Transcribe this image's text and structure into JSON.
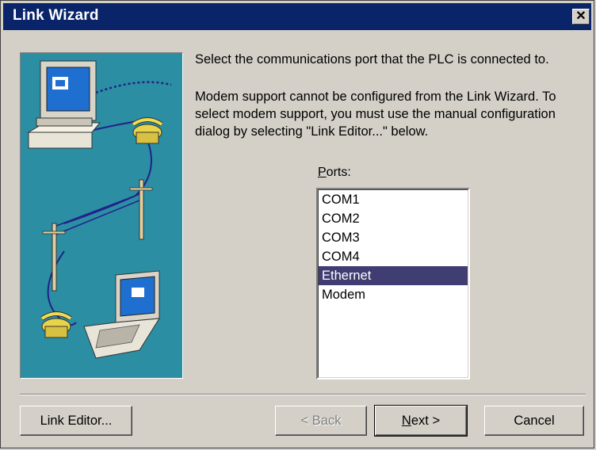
{
  "window": {
    "title": "Link Wizard",
    "close_glyph": "✕"
  },
  "text": {
    "instruction": "Select the communications port that the PLC is connected to.",
    "modem_note": "Modem support cannot be configured from the Link Wizard. To select modem support, you must use the manual configuration dialog by selecting \"Link Editor...\" below."
  },
  "ports": {
    "label_underlined": "P",
    "label_rest": "orts:",
    "items": [
      "COM1",
      "COM2",
      "COM3",
      "COM4",
      "Ethernet",
      "Modem"
    ],
    "selected": "Ethernet"
  },
  "buttons": {
    "link_editor": "Link Editor...",
    "back": "< Back",
    "next_underlined": "N",
    "next_rest": "ext >",
    "cancel": "Cancel"
  },
  "illustration": {
    "icons": [
      "desktop-computer-icon",
      "telephone-icon",
      "utility-pole-icon",
      "laptop-icon"
    ],
    "background_color": "#2b8ea3"
  }
}
